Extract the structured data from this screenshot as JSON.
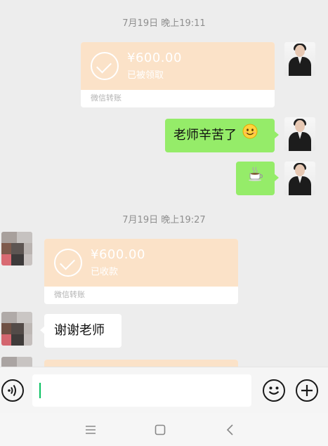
{
  "messages": {
    "ts1": "7月19日 晚上19:11",
    "transfer1": {
      "amount": "¥600.00",
      "status": "已被领取",
      "label": "微信转账"
    },
    "bubble1": "老师辛苦了",
    "emoji1": "smiling-face-emoji",
    "emoji2": "coffee-cup-emoji",
    "ts2": "7月19日 晚上19:27",
    "transfer2": {
      "amount": "¥600.00",
      "status": "已收款",
      "label": "微信转账"
    },
    "bubble2": "谢谢老师"
  },
  "icons": {
    "voice": "voice-input-icon",
    "emoji": "emoji-icon",
    "plus": "plus-icon",
    "nav_menu": "menu-icon",
    "nav_home": "home-icon",
    "nav_back": "back-icon"
  },
  "colors": {
    "background": "#ededed",
    "sent_bubble": "#95ec69",
    "transfer_card": "#fbe2c8",
    "caret": "#07c160"
  }
}
